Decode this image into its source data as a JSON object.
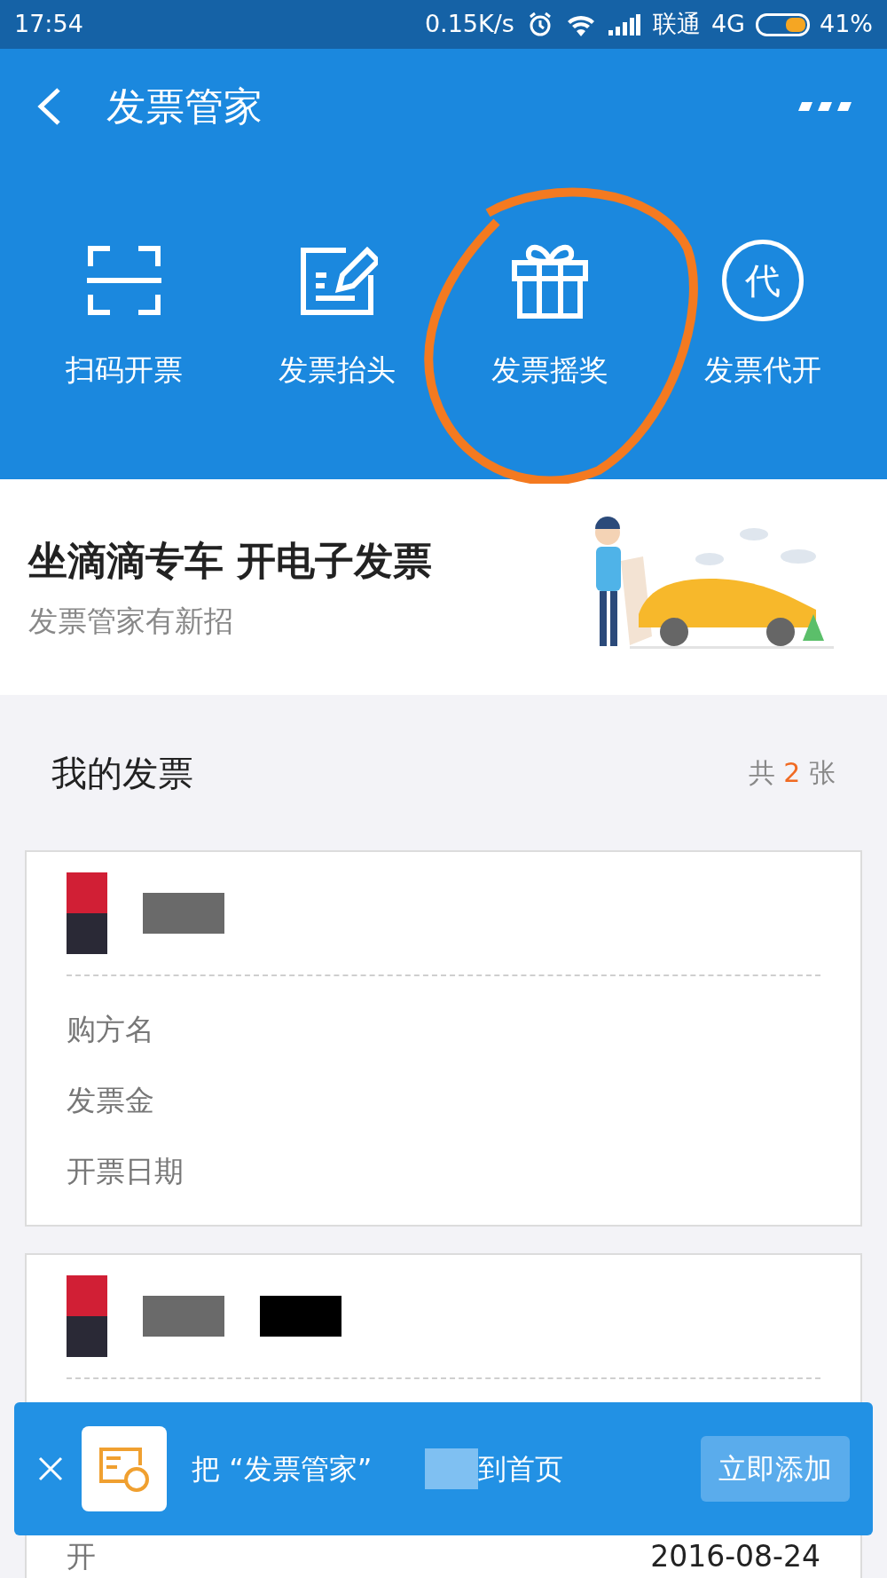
{
  "status_bar": {
    "time": "17:54",
    "speed": "0.15K/s",
    "carrier": "联通",
    "network": "4G",
    "battery": "41%"
  },
  "header": {
    "title": "发票管家"
  },
  "actions": [
    {
      "kind": "scan",
      "label": "扫码开票"
    },
    {
      "kind": "edit",
      "label": "发票抬头"
    },
    {
      "kind": "gift",
      "label": "发票摇奖"
    },
    {
      "kind": "agent",
      "label": "发票代开",
      "icon_text": "代"
    }
  ],
  "promo": {
    "title": "坐滴滴专车 开电子发票",
    "subtitle": "发票管家有新招"
  },
  "invoices": {
    "title": "我的发票",
    "count_prefix": "共",
    "count": "2",
    "count_suffix": "张"
  },
  "cards": [
    {
      "fields": [
        {
          "label": "购方名"
        },
        {
          "label": "发票金"
        },
        {
          "label": "开票日期"
        }
      ]
    },
    {
      "fields": [
        {
          "label": "开",
          "value": "2016-08-24"
        }
      ]
    }
  ],
  "add_bar": {
    "text_before": "把 “发票管家”",
    "text_after": "到首页",
    "button": "立即添加"
  }
}
